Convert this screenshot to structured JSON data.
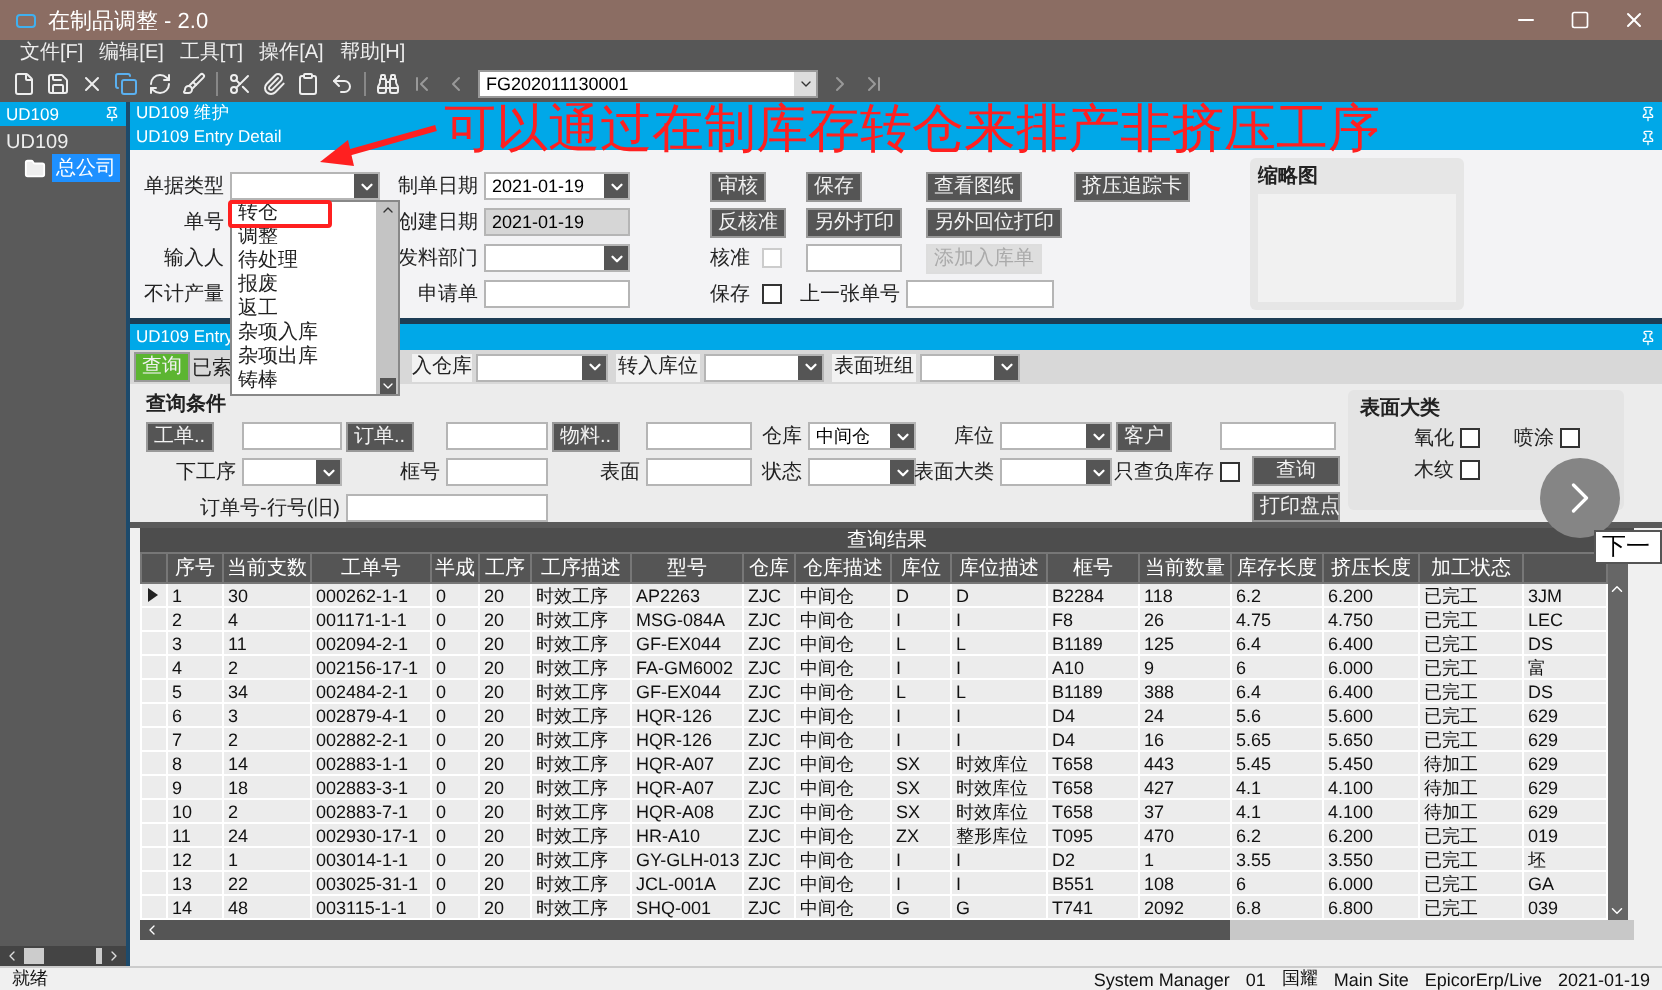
{
  "window": {
    "title": "在制品调整 - 2.0"
  },
  "menu": [
    "文件[F]",
    "编辑[E]",
    "工具[T]",
    "操作[A]",
    "帮助[H]"
  ],
  "toolbar": {
    "record": "FG202011130001"
  },
  "sidebar": {
    "title": "UD109",
    "tree": [
      {
        "label": "UD109",
        "children": [
          {
            "label": "总公司",
            "selected": true
          }
        ]
      }
    ]
  },
  "detail": {
    "header": "UD109 维护",
    "title": "UD109 Entry Detail",
    "rows": [
      [
        {
          "kind": "label",
          "text": "单据类型"
        },
        {
          "kind": "select"
        },
        {
          "kind": "label",
          "text": "制单日期"
        },
        {
          "kind": "select",
          "value": "2021-01-19"
        },
        {
          "kind": "button",
          "text": "审核",
          "disabled": false
        },
        {
          "kind": "button",
          "text": "保存",
          "disabled": false
        },
        {
          "kind": "button",
          "text": "查看图纸",
          "disabled": false
        },
        {
          "kind": "button",
          "text": "挤压追踪卡",
          "disabled": false
        }
      ],
      [
        {
          "kind": "label",
          "text": "单号"
        },
        "",
        {
          "kind": "label",
          "text": "创建日期"
        },
        {
          "kind": "field",
          "value": "2021-01-19",
          "disabled": true
        },
        {
          "kind": "button",
          "text": "反核准",
          "disabled": false
        },
        {
          "kind": "button",
          "text": "另外打印",
          "disabled": false
        },
        {
          "kind": "button",
          "text": "另外回位打印",
          "disabled": false
        }
      ],
      [
        {
          "kind": "label",
          "text": "输入人"
        },
        "",
        {
          "kind": "label",
          "text": "发料部门"
        },
        {
          "kind": "select"
        },
        {
          "kind": "checkbox",
          "label": "核准",
          "checked": false,
          "disabled": true
        },
        {
          "kind": "field",
          "disabled": false
        },
        {
          "kind": "button",
          "text": "添加入库单",
          "disabled": true
        }
      ],
      [
        {
          "kind": "label",
          "text": "不计产量"
        },
        "",
        {
          "kind": "label",
          "text": "申请单"
        },
        {
          "kind": "field",
          "disabled": false
        },
        {
          "kind": "checkbox",
          "label": "保存",
          "checked": false,
          "disabled": false
        },
        {
          "kind": "label",
          "text": "上一张单号"
        },
        {
          "kind": "field",
          "disabled": false
        }
      ]
    ],
    "thumbnail": {
      "title": "缩略图"
    }
  },
  "type_dropdown": {
    "items": [
      "转仓",
      "调整",
      "待处理",
      "报废",
      "返工",
      "杂项入库",
      "杂项出库",
      "铸棒"
    ]
  },
  "annotation": {
    "text": "可以通过在制库存转仓来排产非挤压工序"
  },
  "query": {
    "title": "UD109 Entry",
    "bar": [
      {
        "kind": "primary",
        "text": "查询"
      },
      {
        "kind": "text",
        "text": "已索"
      },
      {
        "kind": "label",
        "text": "入仓库"
      },
      {
        "kind": "select"
      },
      {
        "kind": "label",
        "text": "转入库位"
      },
      {
        "kind": "select"
      },
      {
        "kind": "label",
        "text": "表面班组"
      },
      {
        "kind": "select"
      }
    ],
    "conditions_title": "查询条件",
    "rows": [
      [
        {
          "kind": "button",
          "text": "工单.."
        },
        {
          "kind": "field"
        },
        {
          "kind": "button",
          "text": "订单.."
        },
        {
          "kind": "field"
        },
        {
          "kind": "button",
          "text": "物料.."
        },
        {
          "kind": "field"
        },
        {
          "kind": "label",
          "text": "仓库"
        },
        {
          "kind": "select",
          "value": "中间仓"
        },
        {
          "kind": "label",
          "text": "库位"
        },
        {
          "kind": "select"
        },
        {
          "kind": "button",
          "text": "客户"
        },
        {
          "kind": "field"
        }
      ],
      [
        {
          "kind": "label",
          "text": "下工序"
        },
        {
          "kind": "select"
        },
        {
          "kind": "label",
          "text": "框号"
        },
        {
          "kind": "field"
        },
        {
          "kind": "label",
          "text": "表面"
        },
        {
          "kind": "field"
        },
        {
          "kind": "label",
          "text": "状态"
        },
        {
          "kind": "select"
        },
        {
          "kind": "label",
          "text": "表面大类"
        },
        {
          "kind": "select"
        },
        {
          "kind": "label",
          "text": "只查负库存"
        },
        {
          "kind": "checkbox",
          "checked": false
        }
      ],
      [
        {
          "kind": "label",
          "text": "订单号-行号(旧)"
        },
        {
          "kind": "field"
        }
      ]
    ],
    "actions": [
      {
        "kind": "button",
        "text": "查询"
      },
      {
        "kind": "button",
        "text": "打印盘点"
      }
    ],
    "surface": {
      "title": "表面大类",
      "options": [
        {
          "label": "氧化",
          "checked": false
        },
        {
          "label": "喷涂",
          "checked": false
        },
        {
          "label": "木纹",
          "checked": false
        }
      ]
    }
  },
  "results": {
    "title": "查询结果",
    "columns": [
      "序号",
      "当前支数",
      "工单号",
      "半成",
      "工序",
      "工序描述",
      "型号",
      "仓库",
      "仓库描述",
      "库位",
      "库位描述",
      "框号",
      "当前数量",
      "库存长度",
      "挤压长度",
      "加工状态"
    ],
    "rows": [
      {
        "selected": true,
        "cells": [
          "1",
          "30",
          "000262-1-1",
          "0",
          "20",
          "时效工序",
          "AP2263",
          "ZJC",
          "中间仓",
          "D",
          "D",
          "B2284",
          "118",
          "6.2",
          "6.200",
          "已完工",
          "3JM"
        ]
      },
      {
        "selected": false,
        "cells": [
          "2",
          "4",
          "001171-1-1",
          "0",
          "20",
          "时效工序",
          "MSG-084A",
          "ZJC",
          "中间仓",
          "I",
          "I",
          "F8",
          "26",
          "4.75",
          "4.750",
          "已完工",
          "LEC"
        ]
      },
      {
        "selected": false,
        "cells": [
          "3",
          "11",
          "002094-2-1",
          "0",
          "20",
          "时效工序",
          "GF-EX044",
          "ZJC",
          "中间仓",
          "L",
          "L",
          "B1189",
          "125",
          "6.4",
          "6.400",
          "已完工",
          "DS"
        ]
      },
      {
        "selected": false,
        "cells": [
          "4",
          "2",
          "002156-17-1",
          "0",
          "20",
          "时效工序",
          "FA-GM6002",
          "ZJC",
          "中间仓",
          "I",
          "I",
          "A10",
          "9",
          "6",
          "6.000",
          "已完工",
          "富"
        ]
      },
      {
        "selected": false,
        "cells": [
          "5",
          "34",
          "002484-2-1",
          "0",
          "20",
          "时效工序",
          "GF-EX044",
          "ZJC",
          "中间仓",
          "L",
          "L",
          "B1189",
          "388",
          "6.4",
          "6.400",
          "已完工",
          "DS"
        ]
      },
      {
        "selected": false,
        "cells": [
          "6",
          "3",
          "002879-4-1",
          "0",
          "20",
          "时效工序",
          "HQR-126",
          "ZJC",
          "中间仓",
          "I",
          "I",
          "D4",
          "24",
          "5.6",
          "5.600",
          "已完工",
          "629"
        ]
      },
      {
        "selected": false,
        "cells": [
          "7",
          "2",
          "002882-2-1",
          "0",
          "20",
          "时效工序",
          "HQR-126",
          "ZJC",
          "中间仓",
          "I",
          "I",
          "D4",
          "16",
          "5.65",
          "5.650",
          "已完工",
          "629"
        ]
      },
      {
        "selected": false,
        "cells": [
          "8",
          "14",
          "002883-1-1",
          "0",
          "20",
          "时效工序",
          "HQR-A07",
          "ZJC",
          "中间仓",
          "SX",
          "时效库位",
          "T658",
          "443",
          "5.45",
          "5.450",
          "待加工",
          "629"
        ]
      },
      {
        "selected": false,
        "cells": [
          "9",
          "18",
          "002883-3-1",
          "0",
          "20",
          "时效工序",
          "HQR-A07",
          "ZJC",
          "中间仓",
          "SX",
          "时效库位",
          "T658",
          "427",
          "4.1",
          "4.100",
          "待加工",
          "629"
        ]
      },
      {
        "selected": false,
        "cells": [
          "10",
          "2",
          "002883-7-1",
          "0",
          "20",
          "时效工序",
          "HQR-A08",
          "ZJC",
          "中间仓",
          "SX",
          "时效库位",
          "T658",
          "37",
          "4.1",
          "4.100",
          "待加工",
          "629"
        ]
      },
      {
        "selected": false,
        "cells": [
          "11",
          "24",
          "002930-17-1",
          "0",
          "20",
          "时效工序",
          "HR-A10",
          "ZJC",
          "中间仓",
          "ZX",
          "整形库位",
          "T095",
          "470",
          "6.2",
          "6.200",
          "已完工",
          "019"
        ]
      },
      {
        "selected": false,
        "cells": [
          "12",
          "1",
          "003014-1-1",
          "0",
          "20",
          "时效工序",
          "GY-GLH-013",
          "ZJC",
          "中间仓",
          "I",
          "I",
          "D2",
          "1",
          "3.55",
          "3.550",
          "已完工",
          "坯"
        ]
      },
      {
        "selected": false,
        "cells": [
          "13",
          "22",
          "003025-31-1",
          "0",
          "20",
          "时效工序",
          "JCL-001A",
          "ZJC",
          "中间仓",
          "I",
          "I",
          "B551",
          "108",
          "6",
          "6.000",
          "已完工",
          "GA"
        ]
      },
      {
        "selected": false,
        "cells": [
          "14",
          "48",
          "003115-1-1",
          "0",
          "20",
          "时效工序",
          "SHQ-001",
          "ZJC",
          "中间仓",
          "G",
          "G",
          "T741",
          "2092",
          "6.8",
          "6.800",
          "已完工",
          "039"
        ]
      }
    ]
  },
  "next_button": {
    "tooltip": "下一"
  },
  "status_bar": {
    "message": "就绪",
    "items": [
      "System Manager",
      "01",
      "国耀",
      "Main Site",
      "EpicorErp/Live",
      "2021-01-19"
    ]
  }
}
